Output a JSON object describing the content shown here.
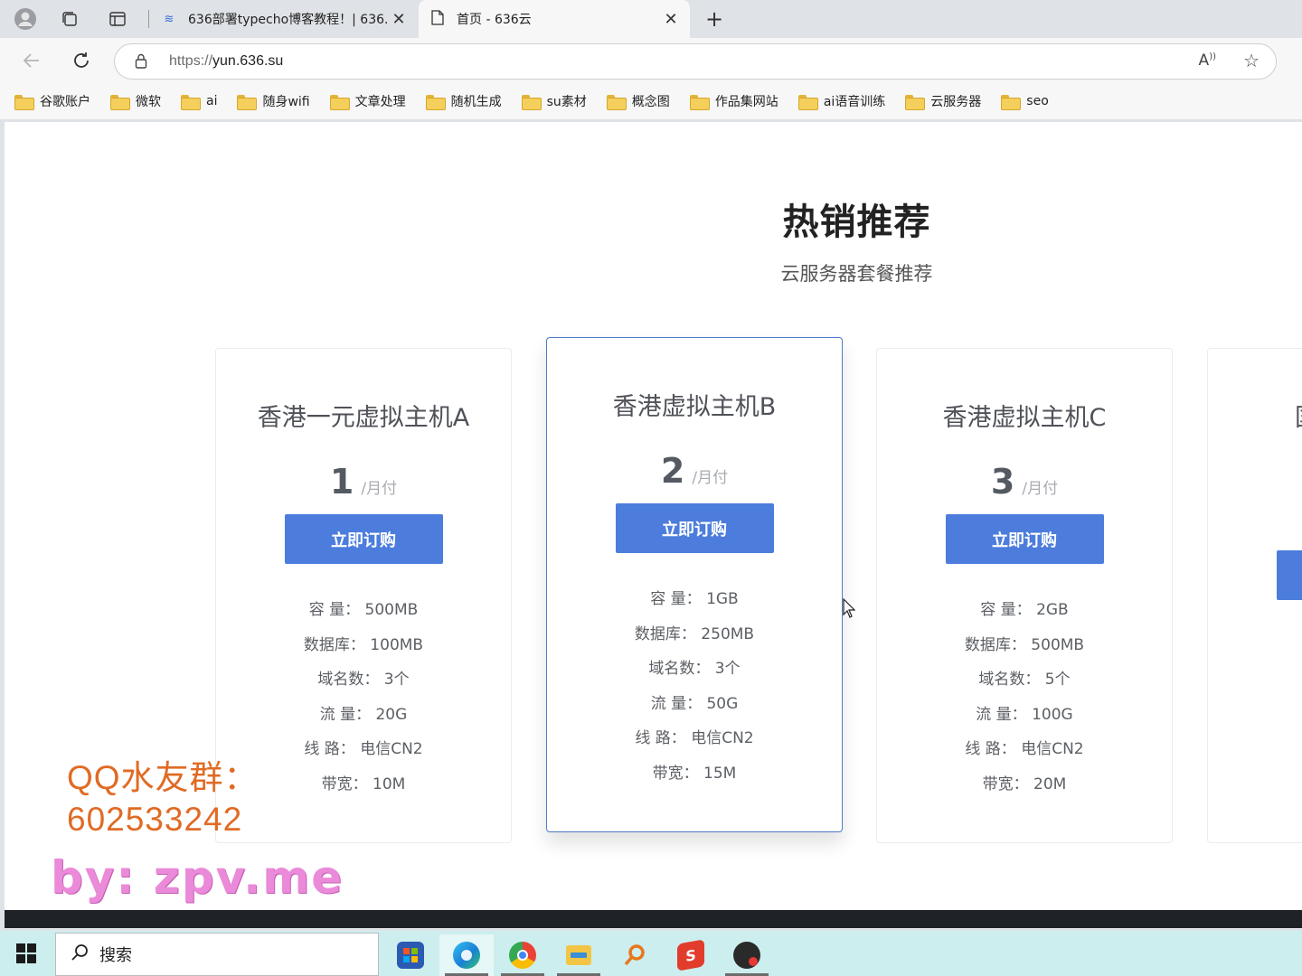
{
  "browser": {
    "tabs": [
      {
        "title": "636部署typecho博客教程！| 636.",
        "active": false
      },
      {
        "title": "首页 - 636云",
        "active": true
      }
    ],
    "new_tab": "+",
    "close": "✕",
    "address": {
      "proto": "https://",
      "host": "yun.636.su"
    }
  },
  "bookmarks": [
    "谷歌账户",
    "微软",
    "ai",
    "随身wifi",
    "文章处理",
    "随机生成",
    "su素材",
    "概念图",
    "作品集网站",
    "ai语音训练",
    "云服务器",
    "seo"
  ],
  "section": {
    "title": "热销推荐",
    "subtitle": "云服务器套餐推荐"
  },
  "plans": [
    {
      "name": "香港一元虚拟主机A",
      "price": "1",
      "period": "/月付",
      "button": "立即订购",
      "specs": [
        "容 量： 500MB",
        "数据库： 100MB",
        "域名数： 3个",
        "流 量： 20G",
        "线 路： 电信CN2",
        "带宽： 10M"
      ]
    },
    {
      "name": "香港虚拟主机B",
      "price": "2",
      "period": "/月付",
      "button": "立即订购",
      "specs": [
        "容 量： 1GB",
        "数据库： 250MB",
        "域名数： 3个",
        "流 量： 50G",
        "线 路： 电信CN2",
        "带宽： 15M"
      ]
    },
    {
      "name": "香港虚拟主机C",
      "price": "3",
      "period": "/月付",
      "button": "立即订购",
      "specs": [
        "容 量： 2GB",
        "数据库： 500MB",
        "域名数： 5个",
        "流 量： 100G",
        "线 路： 电信CN2",
        "带宽： 20M"
      ]
    },
    {
      "name": "国",
      "button": ""
    }
  ],
  "watermark": {
    "qq_line1": "QQ水友群：",
    "qq_line2": "602533242",
    "by": "by: zpv.me"
  },
  "taskbar": {
    "search_placeholder": "搜索"
  },
  "colors": {
    "accent": "#4c7ddd",
    "featured_border": "#4d7cc7",
    "watermark_orange": "#e06b25",
    "watermark_pink": "#ea8ad9",
    "taskbar": "#cdeeee"
  }
}
